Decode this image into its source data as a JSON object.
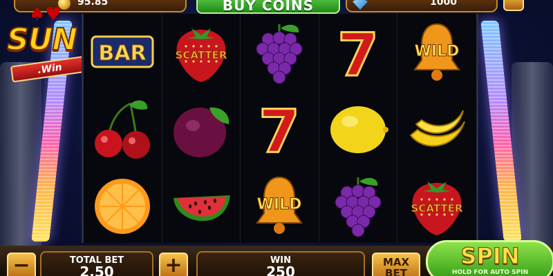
{
  "top": {
    "coins_value": "95.85",
    "buy_label": "BUY COINS",
    "gems_value": "1000"
  },
  "logo": {
    "main": "SUN",
    "ribbon": ".Win"
  },
  "reels": [
    [
      {
        "symbol": "bar",
        "label": "BAR"
      },
      {
        "symbol": "strawberry-scatter",
        "label": "SCATTER"
      },
      {
        "symbol": "grapes",
        "label": ""
      },
      {
        "symbol": "seven",
        "label": "7"
      },
      {
        "symbol": "bell-wild",
        "label": "WILD"
      }
    ],
    [
      {
        "symbol": "cherries",
        "label": ""
      },
      {
        "symbol": "plum",
        "label": ""
      },
      {
        "symbol": "seven",
        "label": "7"
      },
      {
        "symbol": "lemon",
        "label": ""
      },
      {
        "symbol": "banana",
        "label": ""
      }
    ],
    [
      {
        "symbol": "orange",
        "label": ""
      },
      {
        "symbol": "watermelon",
        "label": ""
      },
      {
        "symbol": "bell-wild",
        "label": "WILD"
      },
      {
        "symbol": "grapes",
        "label": ""
      },
      {
        "symbol": "strawberry-scatter",
        "label": "SCATTER"
      }
    ]
  ],
  "bottom": {
    "minus_label": "−",
    "total_bet_label": "TOTAL BET",
    "total_bet_value": "2.50",
    "plus_label": "+",
    "win_label": "WIN",
    "win_value": "250",
    "max_bet_label": "MAX BET",
    "spin_label": "SPIN",
    "spin_sub": "HOLD FOR AUTO SPIN"
  },
  "colors": {
    "reel_bg": "#07080e",
    "gold": "#f5c24a",
    "spin_green": "#2f9a14"
  }
}
